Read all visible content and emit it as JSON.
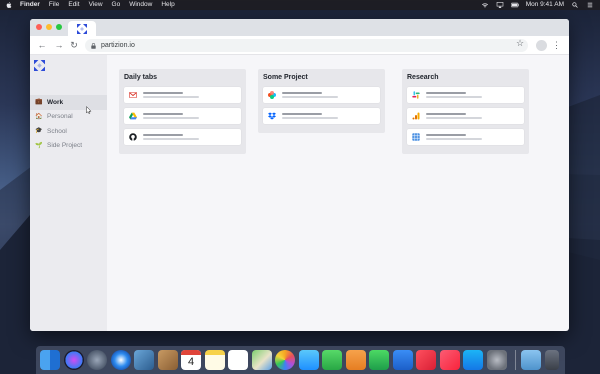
{
  "menubar": {
    "app_name": "Finder",
    "menus": [
      "File",
      "Edit",
      "View",
      "Go",
      "Window",
      "Help"
    ],
    "clock": "Mon 9:41 AM"
  },
  "browser": {
    "url": "partizion.io"
  },
  "sidebar": {
    "items": [
      {
        "label": "Work",
        "emoji": "💼",
        "active": true
      },
      {
        "label": "Personal",
        "emoji": "🏠",
        "active": false
      },
      {
        "label": "School",
        "emoji": "🎓",
        "active": false
      },
      {
        "label": "Side Project",
        "emoji": "🌱",
        "active": false
      }
    ]
  },
  "boards": [
    {
      "title": "Daily tabs",
      "cards": [
        {
          "icon": "gmail-icon"
        },
        {
          "icon": "google-drive-icon"
        },
        {
          "icon": "github-icon"
        }
      ]
    },
    {
      "title": "Some Project",
      "cards": [
        {
          "icon": "figma-icon"
        },
        {
          "icon": "dropbox-icon"
        }
      ]
    },
    {
      "title": "Research",
      "cards": [
        {
          "icon": "slack-icon"
        },
        {
          "icon": "analytics-icon"
        },
        {
          "icon": "calendar-grid-icon"
        }
      ]
    }
  ],
  "dock": {
    "items": [
      "finder-icon",
      "siri-icon",
      "launchpad-icon",
      "safari-icon",
      "photo-viewer-icon",
      "contacts-icon",
      "calendar-icon",
      "notes-icon",
      "reminders-icon",
      "maps-icon",
      "photos-icon",
      "messages-icon",
      "facetime-icon",
      "pages-icon",
      "numbers-icon",
      "keynote-icon",
      "news-icon",
      "music-icon",
      "app-store-icon",
      "system-preferences-icon",
      "downloads-folder-icon",
      "trash-icon"
    ],
    "calendar_day": "4"
  },
  "colors": {
    "accent": "#2d4bd8",
    "sidebar_bg": "#ebebef",
    "board_bg": "#e7e7eb"
  }
}
